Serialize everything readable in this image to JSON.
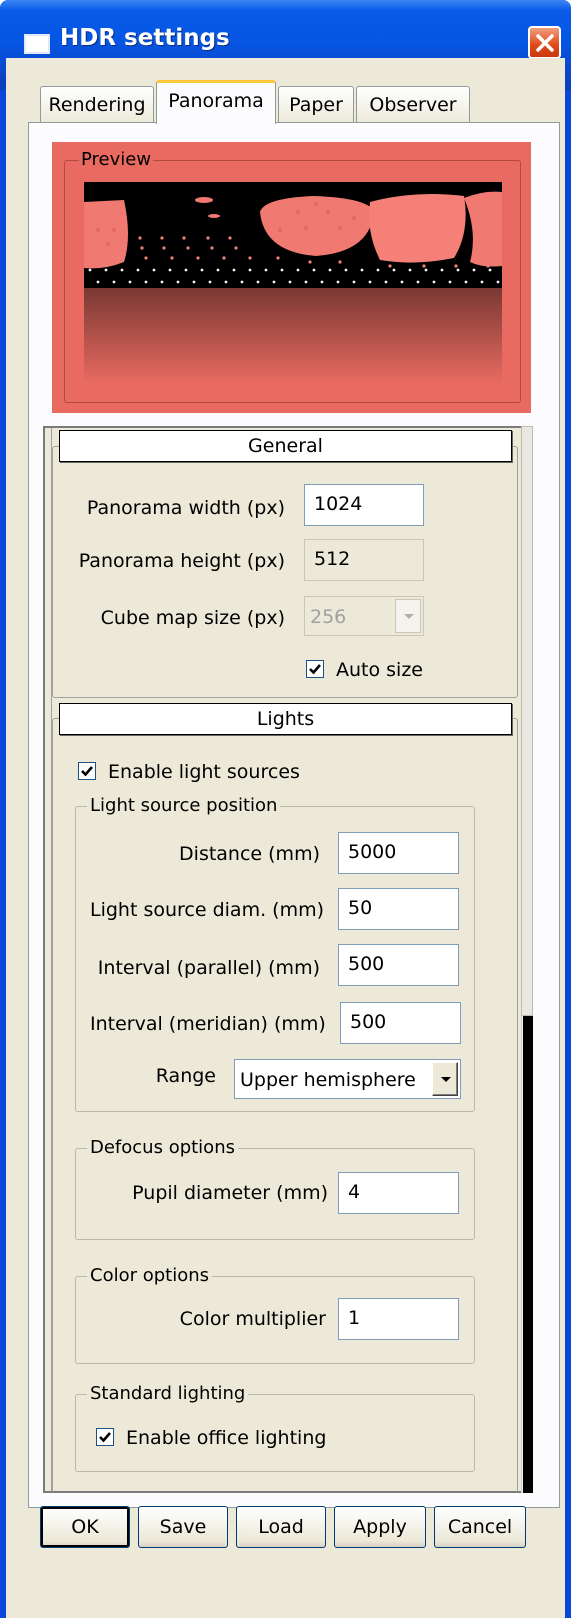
{
  "window": {
    "title": "HDR settings"
  },
  "tabs": [
    "Rendering",
    "Panorama",
    "Paper",
    "Observer"
  ],
  "active_tab": "Panorama",
  "preview": {
    "label": "Preview"
  },
  "general": {
    "header": "General",
    "panorama_width_label": "Panorama width (px)",
    "panorama_width_value": "1024",
    "panorama_height_label": "Panorama height (px)",
    "panorama_height_value": "512",
    "cube_map_label": "Cube map size (px)",
    "cube_map_value": "256",
    "auto_size_label": "Auto size",
    "auto_size_checked": true
  },
  "lights": {
    "header": "Lights",
    "enable_label": "Enable light sources",
    "enable_checked": true,
    "position_group": "Light source position",
    "distance_label": "Distance (mm)",
    "distance_value": "5000",
    "diam_label": "Light source diam. (mm)",
    "diam_value": "50",
    "parallel_label": "Interval (parallel) (mm)",
    "parallel_value": "500",
    "meridian_label": "Interval (meridian) (mm)",
    "meridian_value": "500",
    "range_label": "Range",
    "range_value": "Upper hemisphere",
    "defocus_group": "Defocus options",
    "pupil_label": "Pupil diameter (mm)",
    "pupil_value": "4",
    "color_group": "Color options",
    "multiplier_label": "Color multiplier",
    "multiplier_value": "1",
    "standard_group": "Standard lighting",
    "office_label": "Enable office lighting",
    "office_checked": true
  },
  "buttons": {
    "ok": "OK",
    "save": "Save",
    "load": "Load",
    "apply": "Apply",
    "cancel": "Cancel"
  },
  "colors": {
    "title_bar": "#0a5ae8",
    "preview_bg": "#e86a60",
    "dialog_bg": "#ece9d8"
  }
}
